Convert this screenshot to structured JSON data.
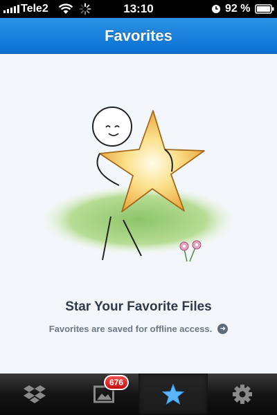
{
  "status_bar": {
    "carrier": "Tele2",
    "time": "13:10",
    "battery_percent": "92 %"
  },
  "header": {
    "title": "Favorites"
  },
  "empty_state": {
    "title": "Star Your Favorite Files",
    "subtitle": "Favorites are saved for offline access.",
    "illustration": "stick-figure-hugging-star",
    "info_icon": "arrow-circle-icon"
  },
  "tab_bar": {
    "tabs": [
      {
        "id": "dropbox",
        "icon": "dropbox-icon",
        "active": false
      },
      {
        "id": "photos",
        "icon": "photos-icon",
        "active": false,
        "badge": "676"
      },
      {
        "id": "favorites",
        "icon": "star-icon",
        "active": true
      },
      {
        "id": "settings",
        "icon": "gear-icon",
        "active": false
      }
    ]
  },
  "colors": {
    "header_blue": "#0a6fd3",
    "active_star": "#5ab4ff",
    "badge_red": "#d71a1a"
  }
}
